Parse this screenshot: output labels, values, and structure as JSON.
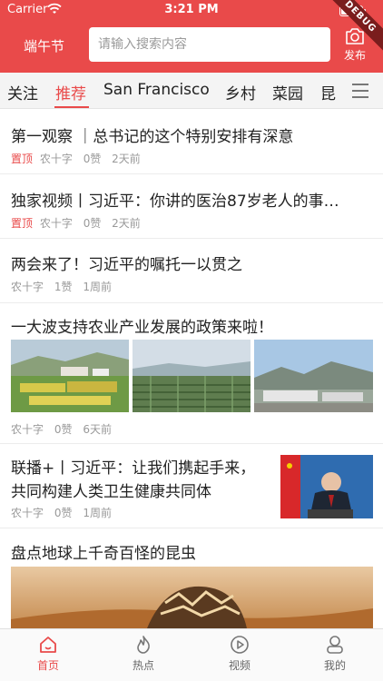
{
  "status_bar": {
    "carrier": "Carrier",
    "time": "3:21 PM",
    "battery_level": 0.95
  },
  "debug_label": "DEBUG",
  "header": {
    "festival": "端午节",
    "search_placeholder": "请输入搜索内容",
    "publish_label": "发布",
    "accent_color": "#e94a4a"
  },
  "tabs": [
    {
      "label": "关注",
      "active": false
    },
    {
      "label": "推荐",
      "active": true
    },
    {
      "label": "San Francisco",
      "active": false
    },
    {
      "label": "乡村",
      "active": false
    },
    {
      "label": "菜园",
      "active": false
    },
    {
      "label": "昆",
      "active": false
    }
  ],
  "feed": [
    {
      "title": "第一观察 ｜总书记的这个特别安排有深意",
      "pinned": "置顶",
      "source": "农十字",
      "likes": "0赞",
      "time": "2天前"
    },
    {
      "title": "独家视频丨习近平：你讲的医治87岁老人的事…",
      "pinned": "置顶",
      "source": "农十字",
      "likes": "0赞",
      "time": "2天前"
    },
    {
      "title": "两会来了！习近平的嘱托一以贯之",
      "source": "农十字",
      "likes": "1赞",
      "time": "1周前"
    },
    {
      "title": "一大波支持农业产业发展的政策来啦！",
      "source": "农十字",
      "likes": "0赞",
      "time": "6天前"
    },
    {
      "title_line1": "联播+丨习近平：让我们携起手来，",
      "title_line2": "共同构建人类卫生健康共同体",
      "source": "农十字",
      "likes": "0赞",
      "time": "1周前"
    },
    {
      "title": "盘点地球上千奇百怪的昆虫"
    }
  ],
  "tabbar": [
    {
      "label": "首页",
      "icon": "home-icon",
      "active": true
    },
    {
      "label": "热点",
      "icon": "flame-icon",
      "active": false
    },
    {
      "label": "视频",
      "icon": "play-circle-icon",
      "active": false
    },
    {
      "label": "我的",
      "icon": "user-icon",
      "active": false
    }
  ]
}
